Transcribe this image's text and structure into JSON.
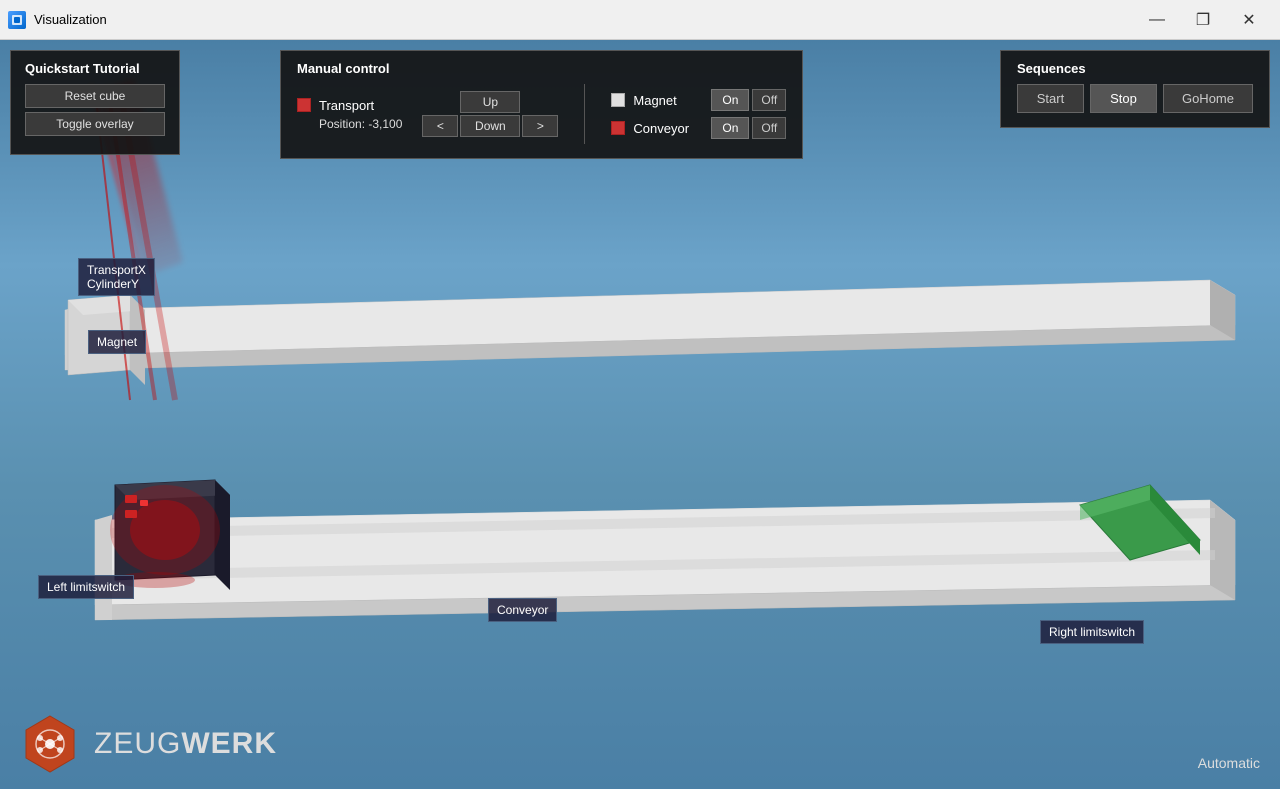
{
  "window": {
    "title": "Visualization",
    "icon_alt": "viz-icon"
  },
  "titlebar": {
    "minimize_label": "—",
    "maximize_label": "❐",
    "close_label": "✕"
  },
  "quickstart": {
    "title": "Quickstart Tutorial",
    "reset_btn": "Reset cube",
    "toggle_btn": "Toggle overlay"
  },
  "manual": {
    "title": "Manual control",
    "transport_label": "Transport",
    "position_label": "Position: -3,100",
    "up_btn": "Up",
    "down_btn": "Down",
    "left_btn": "<",
    "right_btn": ">",
    "magnet_label": "Magnet",
    "conveyor_label": "Conveyor",
    "magnet_on": "On",
    "magnet_off": "Off",
    "conveyor_on": "On",
    "conveyor_off": "Off"
  },
  "sequences": {
    "title": "Sequences",
    "start_btn": "Start",
    "stop_btn": "Stop",
    "gohome_btn": "GoHome"
  },
  "scene_labels": {
    "transport": "TransportX\nCylinderY",
    "transport_line1": "TransportX",
    "transport_line2": "CylinderY",
    "magnet": "Magnet",
    "left_limitswitch": "Left limitswitch",
    "conveyor": "Conveyor",
    "right_limitswitch": "Right limitswitch"
  },
  "branding": {
    "name_light": "ZEUG",
    "name_bold": "WERK"
  },
  "mode": {
    "label": "Automatic"
  }
}
